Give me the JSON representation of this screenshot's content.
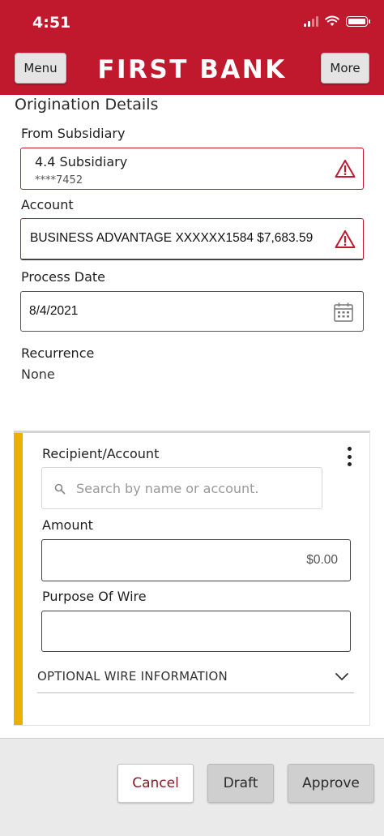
{
  "status_bar": {
    "time": "4:51",
    "icons": [
      "signal-icon",
      "wifi-icon",
      "battery-icon"
    ]
  },
  "header": {
    "menu_label": "Menu",
    "brand": "FIRST BANK",
    "more_label": "More",
    "color": "#c0182d"
  },
  "origination": {
    "title": "Origination Details",
    "from_subsidiary_label": "From Subsidiary",
    "subsidiary_name": "4.4 Subsidiary",
    "subsidiary_number": "****7452",
    "account_label": "Account",
    "account_value": "BUSINESS ADVANTAGE XXXXXX1584 $7,683.59",
    "process_date_label": "Process Date",
    "process_date_value": "8/4/2021",
    "recurrence_label": "Recurrence",
    "recurrence_value": "None"
  },
  "recipient_card": {
    "accent_color": "#e9b000",
    "recipient_label": "Recipient/Account",
    "search_placeholder": "Search by name or account.",
    "amount_label": "Amount",
    "amount_value": "$0.00",
    "purpose_label": "Purpose Of Wire",
    "purpose_value": "",
    "optional_label": "OPTIONAL WIRE INFORMATION"
  },
  "footer": {
    "cancel_label": "Cancel",
    "draft_label": "Draft",
    "approve_label": "Approve"
  }
}
